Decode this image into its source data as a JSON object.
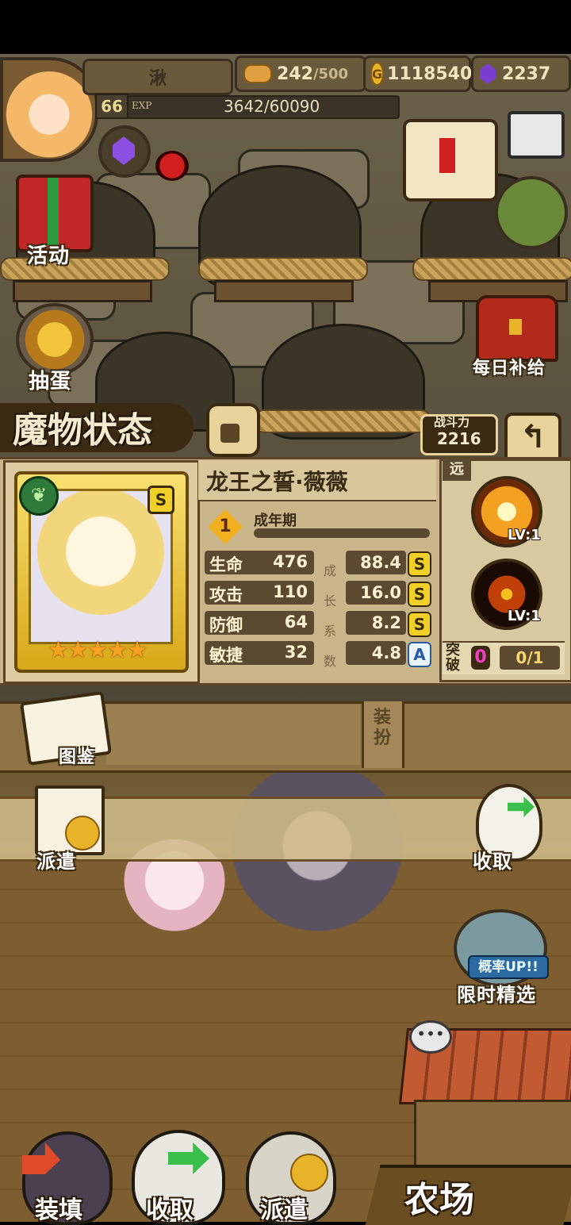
{
  "header": {
    "player_name": "湫",
    "stamina": "242",
    "stamina_max": "/500",
    "gold": "1118540",
    "gems": "2237",
    "level": "66",
    "exp_label": "EXP",
    "exp_value": "3642/60090"
  },
  "side_menu": {
    "activity": "活动",
    "gacha": "抽蛋",
    "daily_supply": "每日补给"
  },
  "status": {
    "title": "魔物状态",
    "power_label": "战斗力",
    "power_value": "2216",
    "monster_name": "龙王之誓·薇薇",
    "rarity_badge": "S",
    "stage_badge": "1",
    "stage_label": "成年期",
    "growth_caption": [
      "成",
      "长",
      "系",
      "数"
    ],
    "stats": [
      {
        "name": "生命",
        "value": "476",
        "growth": "88.4",
        "grade": "S"
      },
      {
        "name": "攻击",
        "value": "110",
        "growth": "16.0",
        "grade": "S"
      },
      {
        "name": "防御",
        "value": "64",
        "growth": "8.2",
        "grade": "S"
      },
      {
        "name": "敏捷",
        "value": "32",
        "growth": "4.8",
        "grade": "A"
      }
    ],
    "range_tag": "远",
    "skills": [
      {
        "level": "LV:1"
      },
      {
        "level": "LV:1"
      }
    ],
    "breakthrough_label": "突破",
    "breakthrough_count": "0",
    "breakthrough_progress": "0/1",
    "equip_label": "装扮"
  },
  "actions": {
    "codex": "图鉴",
    "dispatch": "派遣",
    "collect": "收取",
    "limited": "限时精选",
    "rate_up": "概率UP!!"
  },
  "bottom_nav": {
    "load": "装填",
    "collect": "收取",
    "dispatch": "派遣",
    "farm": "农场"
  },
  "colors": {
    "panel_bg": "#c8b68a",
    "frame_dark": "#5a4626",
    "gold_card": "#f2d02a"
  }
}
